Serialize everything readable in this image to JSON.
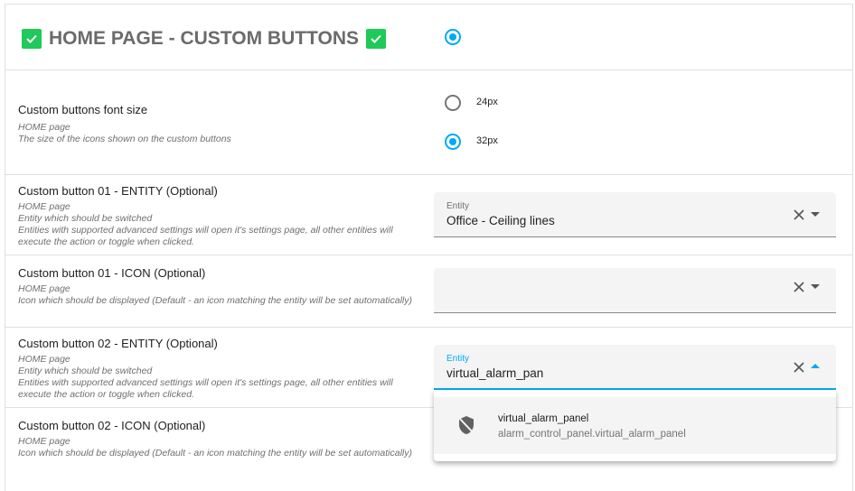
{
  "section": {
    "title": "HOME PAGE - CUSTOM BUTTONS",
    "check_color": "#1fc95a",
    "toggle_selected": true
  },
  "font_size": {
    "name": "Custom buttons font size",
    "desc1": "HOME page",
    "desc2": "The size of the icons shown on the custom buttons",
    "options": [
      {
        "label": "24px",
        "selected": false
      },
      {
        "label": "32px",
        "selected": true
      }
    ]
  },
  "rows": [
    {
      "name": "Custom button 01 - ENTITY (Optional)",
      "desc1": "HOME page",
      "desc2": "Entity which should be switched",
      "desc3": "Entities with supported advanced settings will open it's settings page, all other entities will execute the action or toggle when clicked.",
      "field_label": "Entity",
      "field_value": "Office - Ceiling lines"
    },
    {
      "name": "Custom button 01 - ICON (Optional)",
      "desc1": "HOME page",
      "desc2": "Icon which should be displayed (Default - an icon matching the entity will be set automatically)",
      "field_value": ""
    },
    {
      "name": "Custom button 02 - ENTITY (Optional)",
      "desc1": "HOME page",
      "desc2": "Entity which should be switched",
      "desc3": "Entities with supported advanced settings will open it's settings page, all other entities will execute the action or toggle when clicked.",
      "field_label": "Entity",
      "field_value": "virtual_alarm_pan"
    },
    {
      "name": "Custom button 02 - ICON (Optional)",
      "desc1": "HOME page",
      "desc2": "Icon which should be displayed (Default - an icon matching the entity will be set automatically)"
    }
  ],
  "dropdown": {
    "options": [
      {
        "name": "virtual_alarm_panel",
        "entity_id": "alarm_control_panel.virtual_alarm_panel",
        "icon": "shield-off-icon"
      }
    ]
  },
  "accent": "#03a9f4"
}
